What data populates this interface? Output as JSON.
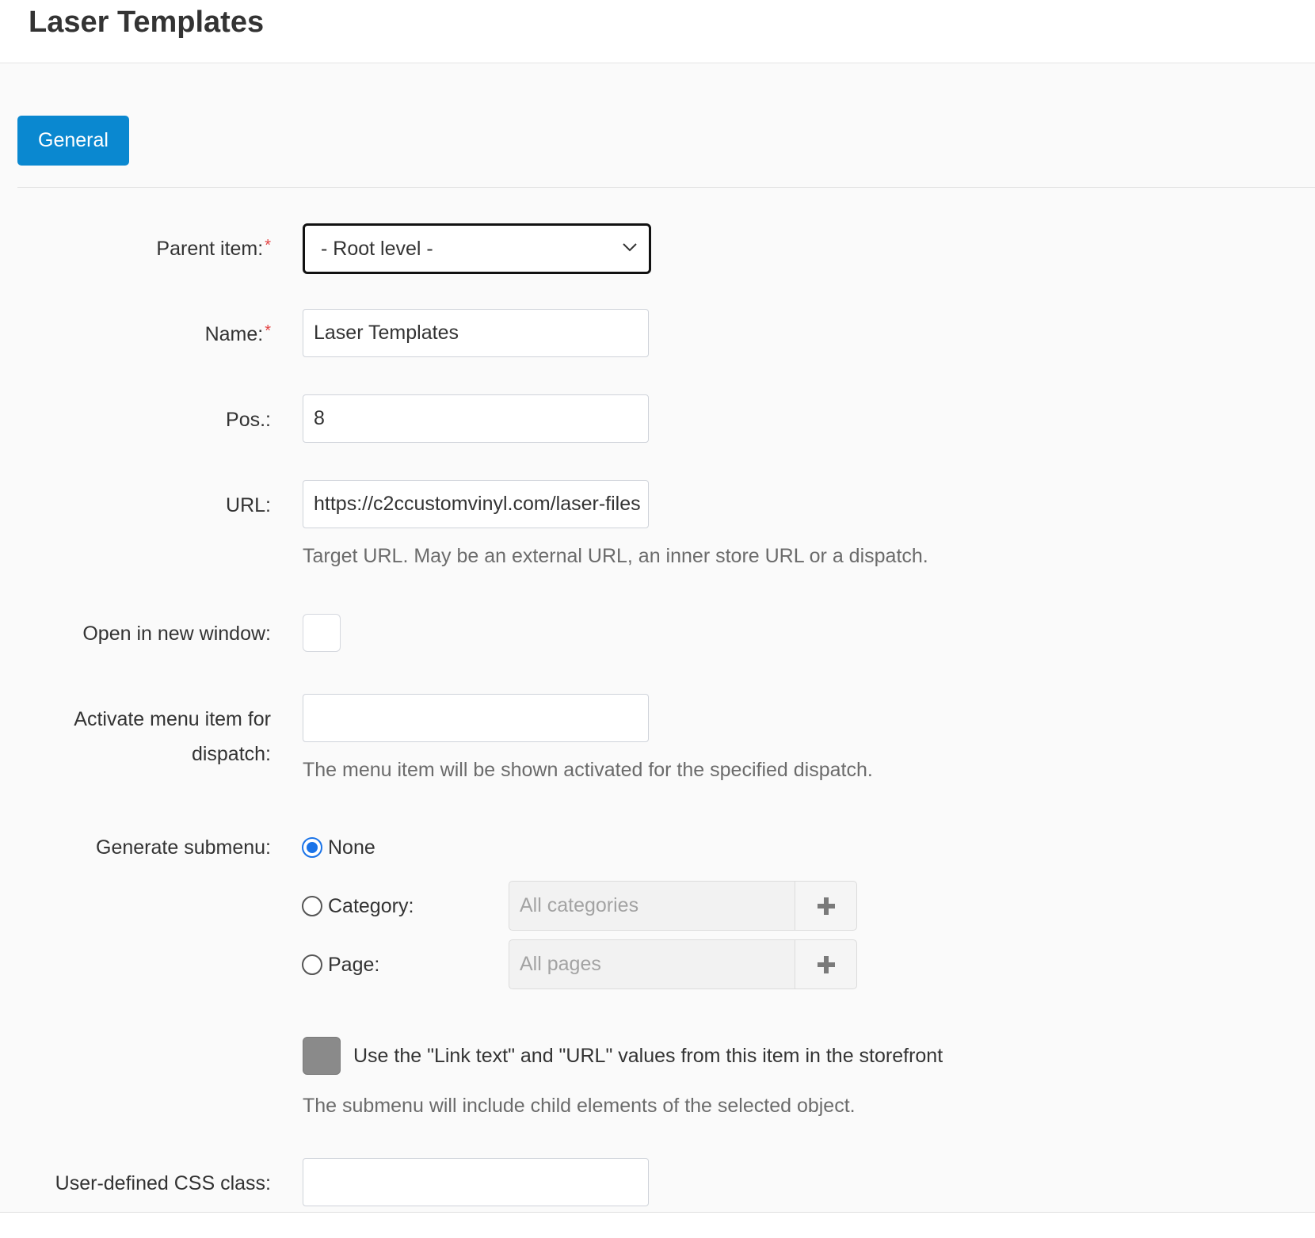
{
  "header": {
    "title": "Laser Templates"
  },
  "tabs": [
    {
      "label": "General"
    }
  ],
  "form": {
    "parent_item": {
      "label": "Parent item:",
      "required_mark": "*",
      "selected": "- Root level -"
    },
    "name": {
      "label": "Name:",
      "required_mark": "*",
      "value": "Laser Templates"
    },
    "pos": {
      "label": "Pos.:",
      "value": "8"
    },
    "url": {
      "label": "URL:",
      "value": "https://c2ccustomvinyl.com/laser-files",
      "help": "Target URL. May be an external URL, an inner store URL or a dispatch."
    },
    "open_new_window": {
      "label": "Open in new window:",
      "checked": false
    },
    "activate_dispatch": {
      "label": "Activate menu item for dispatch:",
      "value": "",
      "help": "The menu item will be shown activated for the specified dispatch."
    },
    "generate_submenu": {
      "label": "Generate submenu:",
      "options": [
        {
          "label": "None",
          "checked": true
        },
        {
          "label": "Category:",
          "checked": false,
          "picker_placeholder": "All categories"
        },
        {
          "label": "Page:",
          "checked": false,
          "picker_placeholder": "All pages"
        }
      ],
      "use_link_text_label": "Use the \"Link text\" and \"URL\" values from this item in the storefront",
      "help": "The submenu will include child elements of the selected object."
    },
    "css_class": {
      "label": "User-defined CSS class:",
      "value": ""
    }
  },
  "colors": {
    "accent": "#0a88d0",
    "required": "#e34343",
    "radio_checked": "#1a73e8"
  },
  "icons": {
    "select_arrow": "chevron-down-icon",
    "picker_add": "plus-icon"
  }
}
